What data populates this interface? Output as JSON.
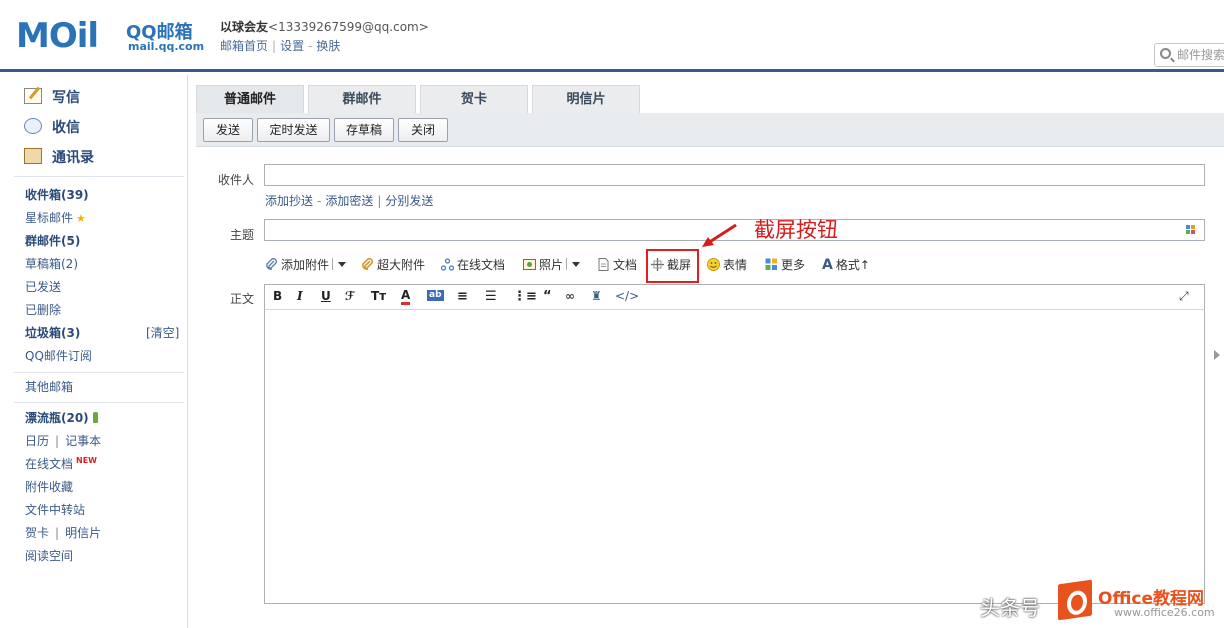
{
  "header": {
    "logo_mail": "MOil",
    "logo_qq": "QQ邮箱",
    "logo_domain": "mail.qq.com",
    "user_name": "以球会友",
    "user_email": "<13339267599@qq.com>",
    "links": [
      "邮箱首页",
      "设置",
      "换肤"
    ],
    "search_placeholder": "邮件搜索"
  },
  "sidebar": {
    "main_items": [
      "写信",
      "收信",
      "通讯录"
    ],
    "folders": [
      {
        "label": "收件箱(39)",
        "bold": true
      },
      {
        "label": "星标邮件",
        "star": true
      },
      {
        "label": "群邮件(5)",
        "bold": true
      },
      {
        "label": "草稿箱(2)"
      },
      {
        "label": "已发送"
      },
      {
        "label": "已删除"
      },
      {
        "label": "垃圾箱(3)",
        "bold": true
      },
      {
        "label": "QQ邮件订阅"
      }
    ],
    "clear_label": "[清空]",
    "other_mailbox": "其他邮箱",
    "bottle": "漂流瓶(20)",
    "calendar": "日历",
    "notebook": "记事本",
    "online_docs": "在线文档",
    "new_tag": "NEW",
    "attachments": "附件收藏",
    "file_transfer": "文件中转站",
    "greeting_card": "贺卡",
    "postcard": "明信片",
    "reading_space": "阅读空间"
  },
  "tabs": [
    "普通邮件",
    "群邮件",
    "贺卡",
    "明信片"
  ],
  "toolbar": {
    "send": "发送",
    "scheduled": "定时发送",
    "save_draft": "存草稿",
    "close": "关闭"
  },
  "compose": {
    "to_label": "收件人",
    "to_value": "",
    "cc_link": "添加抄送",
    "bcc_link": "添加密送",
    "separate_link": "分别发送",
    "subject_label": "主题",
    "subject_value": "",
    "body_label": "正文"
  },
  "attach_bar": {
    "add_attachment": "添加附件",
    "large_attachment": "超大附件",
    "online_doc": "在线文档",
    "photo": "照片",
    "document": "文档",
    "screenshot": "截屏",
    "emoji": "表情",
    "more": "更多",
    "format": "格式↑"
  },
  "annotation": "截屏按钮",
  "watermark": {
    "source": "头条号",
    "brand": "Office教程网",
    "url": "www.office26.com"
  },
  "colors": {
    "accent": "#3a5a86",
    "link": "#3a5a88",
    "highlight": "#e02020"
  }
}
